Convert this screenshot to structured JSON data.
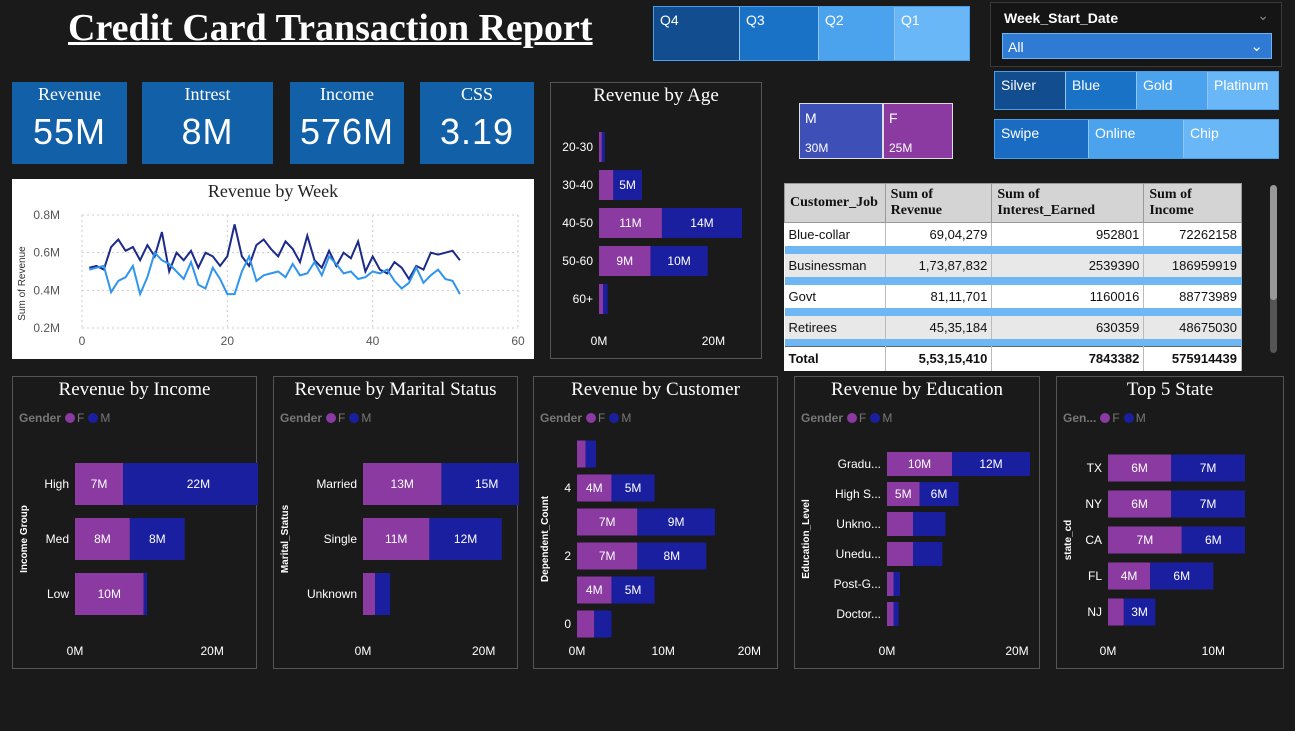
{
  "title": "Credit Card Transaction Report",
  "quarter_slicer": {
    "options": [
      "Q4",
      "Q3",
      "Q2",
      "Q1"
    ],
    "colors": [
      "#114d8f",
      "#1a72c6",
      "#4ba3ee",
      "#6ab7f7"
    ]
  },
  "week_slicer": {
    "label": "Week_Start_Date",
    "value": "All"
  },
  "card_slicer": {
    "options": [
      "Silver",
      "Blue",
      "Gold",
      "Platinum"
    ],
    "colors": [
      "#114d8f",
      "#1a72c6",
      "#4ba3ee",
      "#6ab7f7"
    ]
  },
  "use_slicer": {
    "options": [
      "Swipe",
      "Online",
      "Chip"
    ],
    "colors": [
      "#1a6bc2",
      "#4ba3ee",
      "#6ab7f7"
    ]
  },
  "gender_tiles": [
    {
      "label": "M",
      "value": "30M",
      "color": "#3f4fb8"
    },
    {
      "label": "F",
      "value": "25M",
      "color": "#8a3aa0"
    }
  ],
  "kpis": [
    {
      "label": "Revenue",
      "value": "55M"
    },
    {
      "label": "Intrest",
      "value": "8M"
    },
    {
      "label": "Income",
      "value": "576M"
    },
    {
      "label": "CSS",
      "value": "3.19"
    }
  ],
  "legend": {
    "title": "Gender",
    "short_title": "Gen...",
    "f": "F",
    "m": "M",
    "f_color": "#8a3aa0",
    "m_color": "#1a1fa0"
  },
  "table": {
    "headers": [
      "Customer_Job",
      "Sum of Revenue",
      "Sum of Interest_Earned",
      "Sum of Income"
    ],
    "rows": [
      [
        "Blue-collar",
        "69,04,279",
        "952801",
        "72262158"
      ],
      [
        "Businessman",
        "1,73,87,832",
        "2539390",
        "186959919"
      ],
      [
        "Govt",
        "81,11,701",
        "1160016",
        "88773989"
      ],
      [
        "Retirees",
        "45,35,184",
        "630359",
        "48675030"
      ]
    ],
    "total": [
      "Total",
      "5,53,15,410",
      "7843382",
      "575914439"
    ]
  },
  "chart_data": [
    {
      "id": "week",
      "type": "line",
      "title": "Revenue by Week",
      "ylabel": "Sum of Revenue",
      "xlabel": "",
      "xlim": [
        0,
        60
      ],
      "ylim": [
        0.2,
        0.8
      ],
      "xticks": [
        0,
        20,
        40,
        60
      ],
      "xtick_labels": [
        "0",
        "20",
        "40",
        "60"
      ],
      "yticks": [
        0.2,
        0.4,
        0.6,
        0.8
      ],
      "ytick_labels": [
        "0.2M",
        "0.4M",
        "0.6M",
        "0.8M"
      ],
      "grid": true,
      "series": [
        {
          "color": "#1c2a8a",
          "x": [
            1,
            2,
            3,
            4,
            5,
            6,
            7,
            8,
            9,
            10,
            11,
            12,
            13,
            14,
            15,
            16,
            17,
            18,
            19,
            20,
            21,
            22,
            23,
            24,
            25,
            26,
            27,
            28,
            29,
            30,
            31,
            32,
            33,
            34,
            35,
            36,
            37,
            38,
            39,
            40,
            41,
            42,
            43,
            44,
            45,
            46,
            47,
            48,
            49,
            50,
            51,
            52
          ],
          "y": [
            0.52,
            0.53,
            0.51,
            0.63,
            0.67,
            0.61,
            0.63,
            0.56,
            0.64,
            0.58,
            0.71,
            0.5,
            0.6,
            0.56,
            0.61,
            0.52,
            0.6,
            0.58,
            0.53,
            0.58,
            0.75,
            0.58,
            0.53,
            0.64,
            0.67,
            0.62,
            0.58,
            0.66,
            0.62,
            0.55,
            0.69,
            0.56,
            0.52,
            0.61,
            0.53,
            0.6,
            0.57,
            0.66,
            0.5,
            0.58,
            0.51,
            0.49,
            0.55,
            0.52,
            0.46,
            0.53,
            0.51,
            0.6,
            0.59,
            0.6,
            0.61,
            0.56
          ]
        },
        {
          "color": "#2f95ee",
          "x": [
            1,
            2,
            3,
            4,
            5,
            6,
            7,
            8,
            9,
            10,
            11,
            12,
            13,
            14,
            15,
            16,
            17,
            18,
            19,
            20,
            21,
            22,
            23,
            24,
            25,
            26,
            27,
            28,
            29,
            30,
            31,
            32,
            33,
            34,
            35,
            36,
            37,
            38,
            39,
            40,
            41,
            42,
            43,
            44,
            45,
            46,
            47,
            48,
            49,
            50,
            51,
            52
          ],
          "y": [
            0.51,
            0.52,
            0.53,
            0.39,
            0.45,
            0.47,
            0.53,
            0.38,
            0.47,
            0.6,
            0.56,
            0.54,
            0.5,
            0.46,
            0.55,
            0.43,
            0.41,
            0.52,
            0.46,
            0.38,
            0.38,
            0.5,
            0.58,
            0.45,
            0.48,
            0.49,
            0.5,
            0.47,
            0.54,
            0.48,
            0.49,
            0.55,
            0.48,
            0.58,
            0.54,
            0.49,
            0.5,
            0.46,
            0.47,
            0.5,
            0.49,
            0.51,
            0.45,
            0.41,
            0.44,
            0.52,
            0.44,
            0.48,
            0.51,
            0.46,
            0.45,
            0.38
          ]
        }
      ]
    },
    {
      "id": "age",
      "type": "bar",
      "title": "Revenue by Age",
      "xlim": [
        0,
        25
      ],
      "xticks": [
        0,
        20
      ],
      "xtick_labels": [
        "0M",
        "20M"
      ],
      "categories": [
        "20-30",
        "30-40",
        "40-50",
        "50-60",
        "60+"
      ],
      "series": [
        {
          "name": "F",
          "values": [
            0.5,
            2.5,
            11,
            9,
            0.7
          ],
          "labels": [
            "",
            "",
            "11M",
            "9M",
            ""
          ]
        },
        {
          "name": "M",
          "values": [
            0.5,
            5,
            14,
            10,
            0.8
          ],
          "labels": [
            "",
            "5M",
            "14M",
            "10M",
            ""
          ]
        }
      ]
    },
    {
      "id": "income",
      "type": "bar",
      "title": "Revenue by Income",
      "ylabel": "Income Group",
      "xlim": [
        0,
        28
      ],
      "xticks": [
        0,
        20
      ],
      "xtick_labels": [
        "0M",
        "20M"
      ],
      "categories": [
        "High",
        "Med",
        "Low"
      ],
      "series": [
        {
          "name": "F",
          "values": [
            7,
            8,
            10
          ],
          "labels": [
            "7M",
            "8M",
            "10M"
          ]
        },
        {
          "name": "M",
          "values": [
            22,
            8,
            0.5
          ],
          "labels": [
            "22M",
            "8M",
            ""
          ]
        }
      ]
    },
    {
      "id": "marital",
      "type": "bar",
      "title": "Revenue by Marital Status",
      "ylabel": "Marital_Status",
      "xlim": [
        0,
        30
      ],
      "xticks": [
        0,
        20
      ],
      "xtick_labels": [
        "0M",
        "20M"
      ],
      "categories": [
        "Married",
        "Single",
        "Unknown"
      ],
      "series": [
        {
          "name": "F",
          "values": [
            13,
            11,
            2
          ],
          "labels": [
            "13M",
            "11M",
            ""
          ]
        },
        {
          "name": "M",
          "values": [
            15,
            12,
            2.5
          ],
          "labels": [
            "15M",
            "12M",
            ""
          ]
        }
      ]
    },
    {
      "id": "customer",
      "type": "bar",
      "title": "Revenue by Customer",
      "ylabel": "Dependent_Count",
      "xlim": [
        0,
        21
      ],
      "xticks": [
        0,
        10,
        20
      ],
      "xtick_labels": [
        "0M",
        "10M",
        "20M"
      ],
      "categories": [
        "5",
        "4",
        "3",
        "2",
        "1",
        "0"
      ],
      "category_labels": [
        "",
        "4",
        "",
        "2",
        "",
        "0"
      ],
      "series": [
        {
          "name": "F",
          "values": [
            1,
            4,
            7,
            7,
            4,
            2
          ],
          "labels": [
            "",
            "4M",
            "7M",
            "7M",
            "4M",
            ""
          ]
        },
        {
          "name": "M",
          "values": [
            1.2,
            5,
            9,
            8,
            5,
            2
          ],
          "labels": [
            "",
            "5M",
            "9M",
            "8M",
            "5M",
            ""
          ]
        }
      ]
    },
    {
      "id": "education",
      "type": "bar",
      "title": "Revenue by Education",
      "ylabel": "Education_Level",
      "xlim": [
        0,
        28
      ],
      "xticks": [
        0,
        20
      ],
      "xtick_labels": [
        "0M",
        "20M"
      ],
      "categories": [
        "Gradu...",
        "High S...",
        "Unkno...",
        "Unedu...",
        "Post-G...",
        "Doctor..."
      ],
      "series": [
        {
          "name": "F",
          "values": [
            10,
            5,
            4,
            4,
            1,
            1
          ],
          "labels": [
            "10M",
            "5M",
            "",
            "",
            "",
            ""
          ]
        },
        {
          "name": "M",
          "values": [
            12,
            6,
            5,
            4.5,
            1,
            0.8
          ],
          "labels": [
            "12M",
            "6M",
            "",
            "",
            "",
            ""
          ]
        }
      ]
    },
    {
      "id": "state",
      "type": "bar",
      "title": "Top 5 State",
      "ylabel": "state_cd",
      "xlim": [
        0,
        15
      ],
      "xticks": [
        0,
        10
      ],
      "xtick_labels": [
        "0M",
        "10M"
      ],
      "categories": [
        "TX",
        "NY",
        "CA",
        "FL",
        "NJ"
      ],
      "series": [
        {
          "name": "F",
          "values": [
            6,
            6,
            7,
            4,
            1.5
          ],
          "labels": [
            "6M",
            "6M",
            "7M",
            "4M",
            ""
          ]
        },
        {
          "name": "M",
          "values": [
            7,
            7,
            6,
            6,
            3
          ],
          "labels": [
            "7M",
            "7M",
            "6M",
            "6M",
            "3M"
          ]
        }
      ]
    }
  ]
}
